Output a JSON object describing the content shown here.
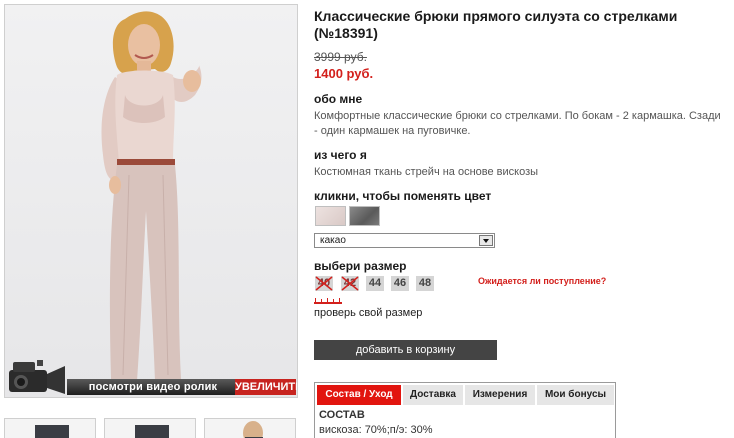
{
  "product": {
    "title": "Классические брюки прямого силуэта со стрелками (№18391)",
    "old_price": "3999 руб.",
    "new_price": "1400 руб."
  },
  "photo": {
    "video_label": "посмотри видео ролик",
    "zoom_label": "УВЕЛИЧИТЬ"
  },
  "about": {
    "heading": "обо мне",
    "text": "Комфортные классические брюки со стрелками. По бокам - 2 кармашка. Сзади - один кармашек на пуговичке."
  },
  "material": {
    "heading": "из чего я",
    "text": "Костюмная ткань стрейч на основе вискозы"
  },
  "color": {
    "heading": "кликни, чтобы поменять цвет",
    "selected": "какао",
    "swatches": [
      "#e5d8d6",
      "#6e6e6e"
    ]
  },
  "size": {
    "heading": "выбери размер",
    "options": [
      {
        "label": "40",
        "available": false
      },
      {
        "label": "42",
        "available": false
      },
      {
        "label": "44",
        "available": true
      },
      {
        "label": "46",
        "available": true
      },
      {
        "label": "48",
        "available": true
      }
    ],
    "await_link": "Ожидается ли поступление?",
    "check_size": "проверь свой размер"
  },
  "cart": {
    "label": "добавить в корзину"
  },
  "tabs": [
    {
      "label": "Состав / Уход",
      "active": true
    },
    {
      "label": "Доставка",
      "active": false
    },
    {
      "label": "Измерения",
      "active": false
    },
    {
      "label": "Мои бонусы",
      "active": false
    }
  ],
  "composition": {
    "title": "СОСТАВ",
    "text": "вискоза: 70%;п/э: 30%"
  },
  "colors": {
    "accent_red": "#d3201c",
    "button_dark": "#444444"
  }
}
